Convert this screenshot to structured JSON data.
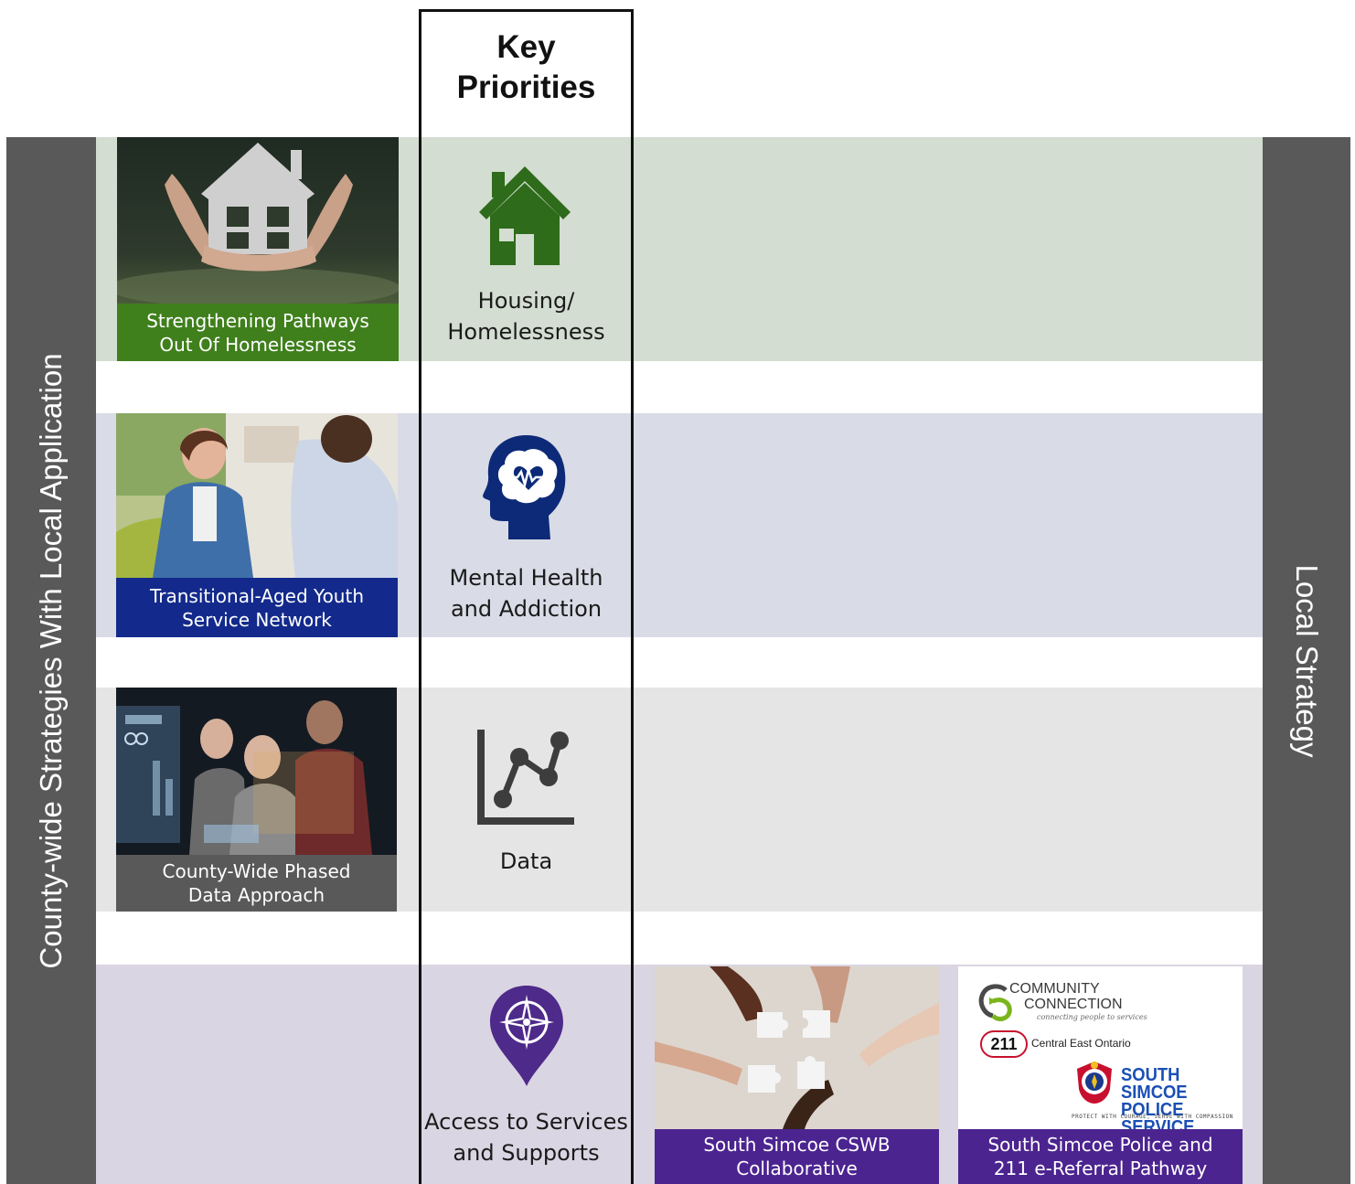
{
  "key_priorities": {
    "title_line1": "Key",
    "title_line2": "Priorities"
  },
  "left_bar": {
    "label": "County-wide Strategies With Local Application"
  },
  "right_bar": {
    "label": "Local Strategy"
  },
  "priorities": [
    {
      "line1": "Housing/",
      "line2": "Homelessness",
      "icon": "house-icon",
      "color": "#2e6b1a"
    },
    {
      "line1": "Mental Health",
      "line2": "and Addiction",
      "icon": "brain-heart-icon",
      "color": "#0d2a78"
    },
    {
      "line1": "Data",
      "line2": "",
      "icon": "line-chart-icon",
      "color": "#3d3d3d"
    },
    {
      "line1": "Access to Services",
      "line2": "and Supports",
      "icon": "compass-pin-icon",
      "color": "#4e2a8a"
    }
  ],
  "cards": {
    "homelessness": {
      "line1": "Strengthening Pathways",
      "line2": "Out Of Homelessness",
      "color": "#3f7f1c"
    },
    "youth": {
      "line1": "Transitional-Aged Youth",
      "line2": "Service Network",
      "color": "#132a8c"
    },
    "data": {
      "line1": "County-Wide Phased",
      "line2": "Data Approach",
      "color": "#595959"
    },
    "cswb": {
      "line1": "South Simcoe CSWB",
      "line2": "Collaborative",
      "color": "#4c2490"
    },
    "referral": {
      "line1": "South Simcoe Police and",
      "line2": "211 e-Referral Pathway",
      "color": "#4c2490"
    }
  },
  "logos": {
    "community_line1": "COMMUNITY",
    "community_line2": "CONNECTION",
    "community_tagline": "connecting people to services",
    "two_eleven": "211",
    "two_eleven_region": "Central East Ontario",
    "police_line1": "SOUTH SIMCOE",
    "police_line2": "POLICE SERVICE",
    "police_motto": "PROTECT WITH COURAGE, SERVE WITH COMPASSION"
  }
}
